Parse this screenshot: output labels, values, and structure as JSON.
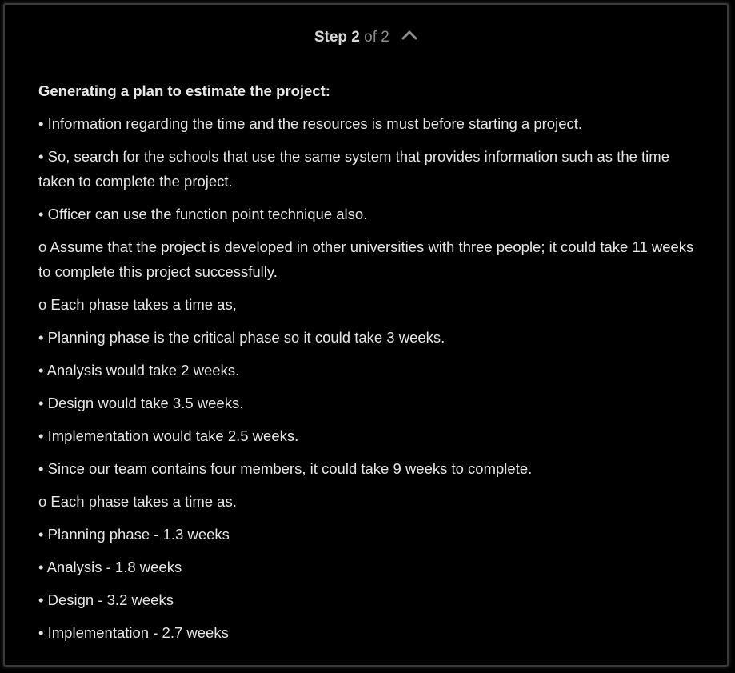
{
  "header": {
    "step_label": "Step 2",
    "step_total": "of 2",
    "toggle_icon": "chevron-up-icon"
  },
  "content": {
    "heading": "Generating a plan to estimate the project:",
    "lines": [
      "• Information regarding the time and the resources is must before starting a project.",
      "• So, search for the schools that use the same system that provides information such as the time taken to complete the project.",
      "• Officer can use the function point technique also.",
      "o Assume that the project is developed in other universities with three people; it could take 11 weeks to complete this project successfully.",
      "o Each phase takes a time as,",
      "• Planning phase is the critical phase so it could take 3 weeks.",
      "• Analysis would take 2 weeks.",
      "• Design would take 3.5 weeks.",
      "• Implementation would take 2.5 weeks.",
      "• Since our team contains four members, it could take 9 weeks to complete.",
      "o Each phase takes a time as.",
      "• Planning phase - 1.3 weeks",
      "• Analysis - 1.8 weeks",
      "• Design - 3.2 weeks",
      "• Implementation - 2.7 weeks"
    ]
  },
  "colors": {
    "background": "#000000",
    "border": "#3a3a3a",
    "text": "#e4e4e4",
    "muted": "#8d8d8d"
  }
}
